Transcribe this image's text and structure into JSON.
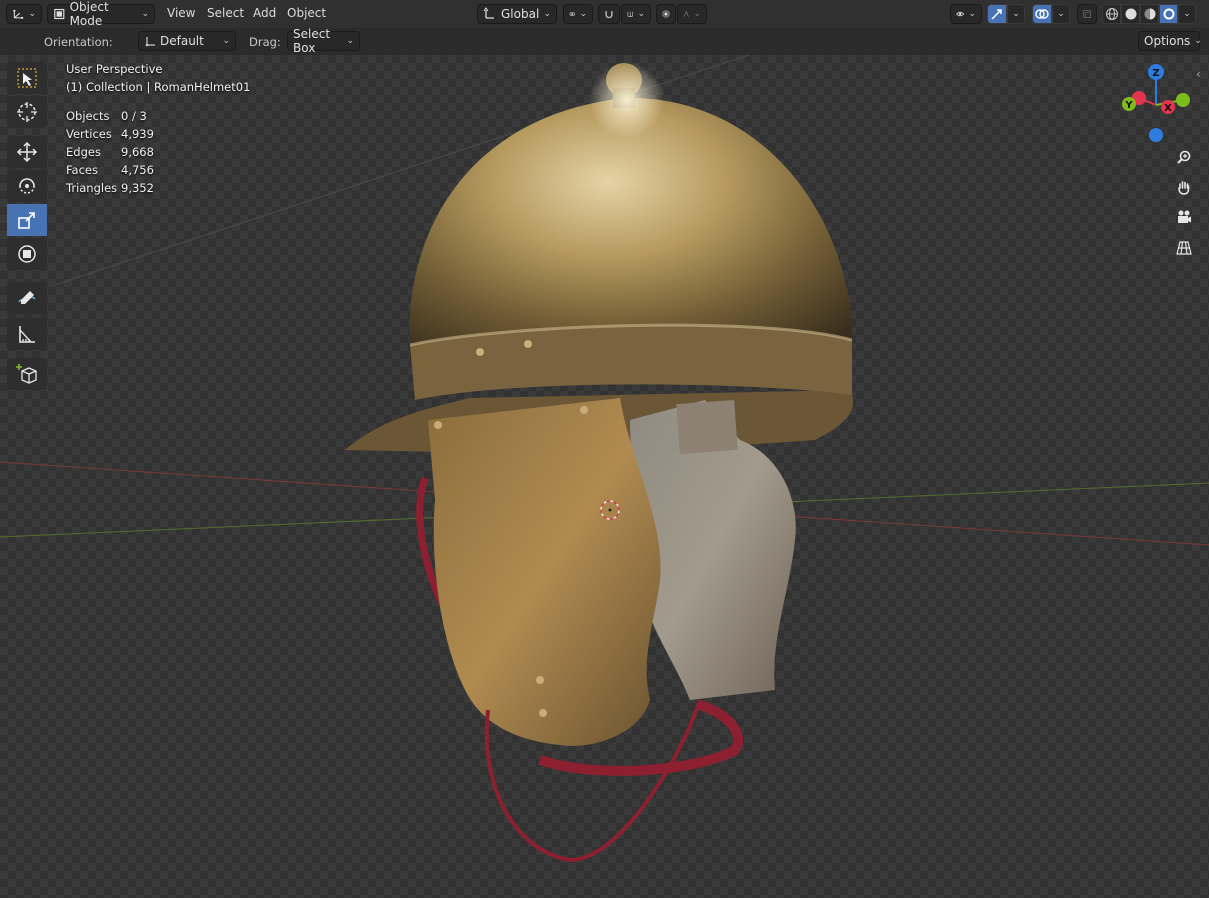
{
  "header": {
    "editor_type_icon": "axis-icon",
    "mode": "Object Mode",
    "menus": [
      "View",
      "Select",
      "Add",
      "Object"
    ],
    "transform_orientation": "Global",
    "pivot_icon": "link-icon",
    "snap_icon": "magnet-icon",
    "snap_target_icon": "snap-grid-icon",
    "proportional_icon": "proportional-icon",
    "falloff_icon": "falloff-curve-icon",
    "visibility_icon": "eye-icon",
    "gizmo_icon": "gizmo-icon",
    "overlay_icon": "overlay-icon",
    "shading_modes": [
      "wireframe",
      "solid",
      "material",
      "rendered"
    ],
    "active_shading": "rendered"
  },
  "tool_options": {
    "orientation_label": "Orientation:",
    "orientation_value": "Default",
    "drag_label": "Drag:",
    "drag_value": "Select Box",
    "options_label": "Options"
  },
  "toolbar": {
    "tools": [
      {
        "name": "select-box",
        "icon": "cursor-select-icon"
      },
      {
        "name": "cursor",
        "icon": "3d-cursor-icon"
      },
      {
        "name": "move",
        "icon": "move-icon"
      },
      {
        "name": "rotate",
        "icon": "rotate-icon"
      },
      {
        "name": "scale",
        "icon": "scale-icon",
        "active": true
      },
      {
        "name": "transform",
        "icon": "transform-icon"
      },
      {
        "name": "annotate",
        "icon": "annotate-icon"
      },
      {
        "name": "measure",
        "icon": "measure-icon"
      },
      {
        "name": "add-cube",
        "icon": "add-cube-icon"
      }
    ]
  },
  "viewport": {
    "view_name": "User Perspective",
    "collection_info": "(1) Collection | RomanHelmet01",
    "stats": [
      {
        "label": "Objects",
        "value": "0 / 3"
      },
      {
        "label": "Vertices",
        "value": "4,939"
      },
      {
        "label": "Edges",
        "value": "9,668"
      },
      {
        "label": "Faces",
        "value": "4,756"
      },
      {
        "label": "Triangles",
        "value": "9,352"
      }
    ],
    "gizmo": {
      "x": "X",
      "y": "Y",
      "z": "Z"
    },
    "nav_buttons": [
      "zoom-icon",
      "hand-pan-icon",
      "camera-icon",
      "grid-view-icon"
    ]
  },
  "colors": {
    "accent": "#4772b3",
    "axis_x": "#e5344e",
    "axis_y": "#7dbd1b",
    "axis_z": "#2e7ce0"
  }
}
